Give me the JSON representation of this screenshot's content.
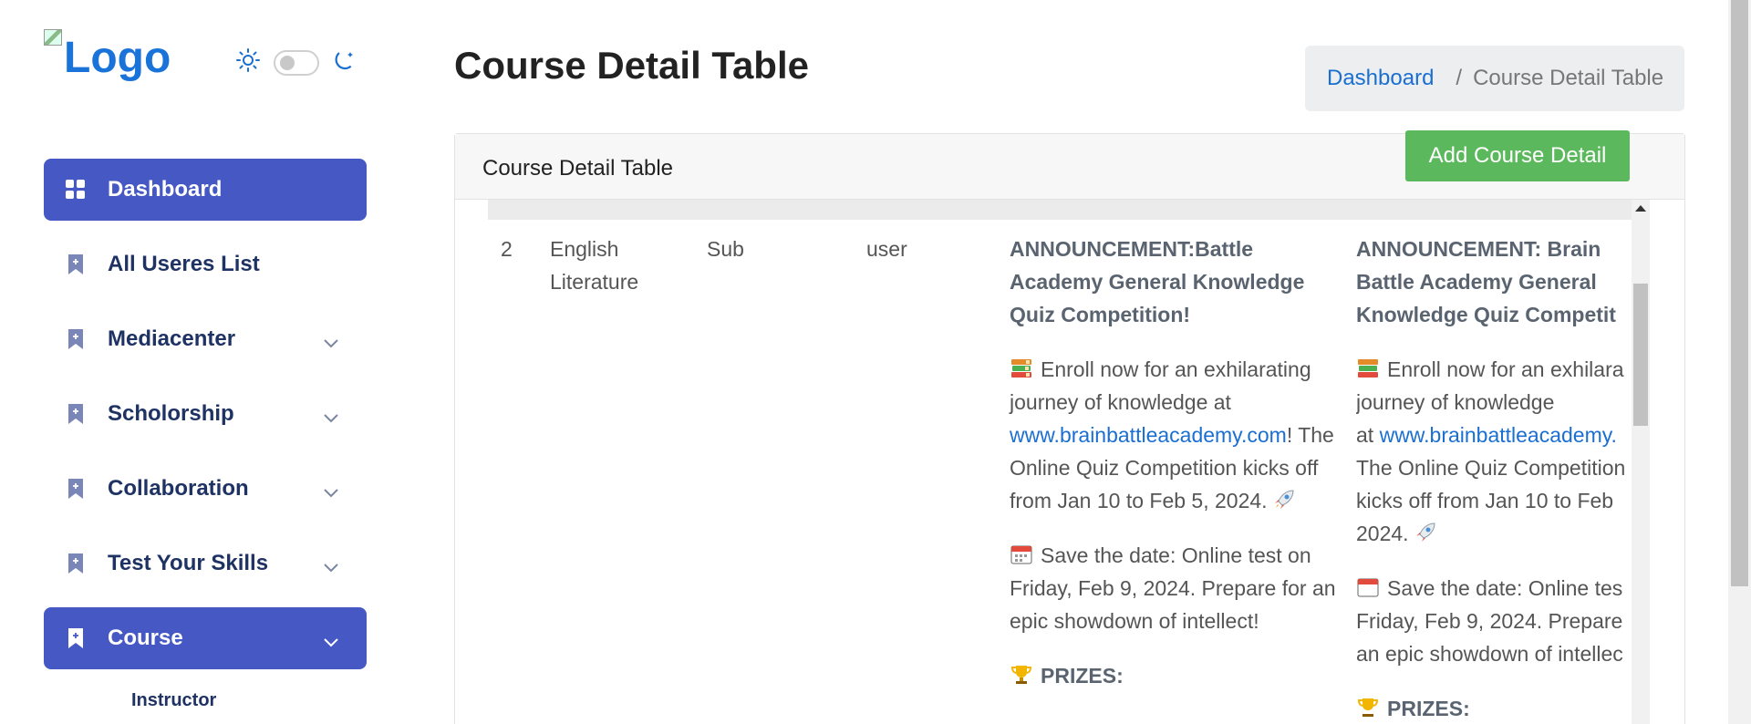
{
  "sidebar": {
    "logo_alt": "Logo",
    "nav": [
      {
        "label": "Dashboard",
        "active": true
      },
      {
        "label": "All Useres List"
      },
      {
        "label": "Mediacenter",
        "chevron": true
      },
      {
        "label": "Scholorship",
        "chevron": true
      },
      {
        "label": "Collaboration",
        "chevron": true
      },
      {
        "label": "Test Your Skills",
        "chevron": true
      },
      {
        "label": "Course",
        "chevron": true,
        "active": true
      }
    ],
    "sub_items": [
      "Instructor"
    ]
  },
  "header": {
    "title": "Course Detail Table",
    "breadcrumb": {
      "link": "Dashboard",
      "separator": "/",
      "current": "Course Detail Table"
    }
  },
  "card": {
    "title": "Course Detail Table",
    "add_button": "Add Course Detail"
  },
  "table": {
    "row": {
      "no": "2",
      "name": "English Literature",
      "type": "Sub",
      "user": "user",
      "desc1": {
        "title": "ANNOUNCEMENT:Battle Academy General Knowledge Quiz Competition!",
        "p1_pre": "Enroll now for an exhilarating journey of knowledge at ",
        "p1_link": "www.brainbattleacademy.com",
        "p1_post": "! The Online Quiz Competition kicks off from Jan 10 to Feb 5, 2024.",
        "p2": "Save the date: Online test on Friday, Feb 9, 2024. Prepare for an epic showdown of intellect!",
        "p3": "PRIZES:"
      },
      "desc2": {
        "title_lines": [
          "ANNOUNCEMENT: Brain",
          "Battle Academy General",
          "Knowledge Quiz Competit"
        ],
        "p1_lines": [
          "Enroll now for an exhilara",
          "journey of knowledge"
        ],
        "p1_at": "at ",
        "p1_link": "www.brainbattleacademy.",
        "p1_rest": [
          "The Online Quiz Competition",
          "kicks off from Jan 10 to Feb"
        ],
        "p1_year": "2024.",
        "p2_lines": [
          "Save the date: Online tes",
          "Friday, Feb 9, 2024. Prepare",
          "an epic showdown of intellec"
        ],
        "p3": "PRIZES:"
      }
    }
  },
  "colors": {
    "accent": "#4558c3",
    "success": "#5cb85c",
    "link": "#1a6fd1"
  },
  "icons": [
    "sun-icon",
    "moon-icon",
    "dashboard-grid-icon",
    "bookmark-plus-icon",
    "chevron-down-icon",
    "books-icon",
    "rocket-icon",
    "calendar-icon",
    "trophy-icon"
  ]
}
